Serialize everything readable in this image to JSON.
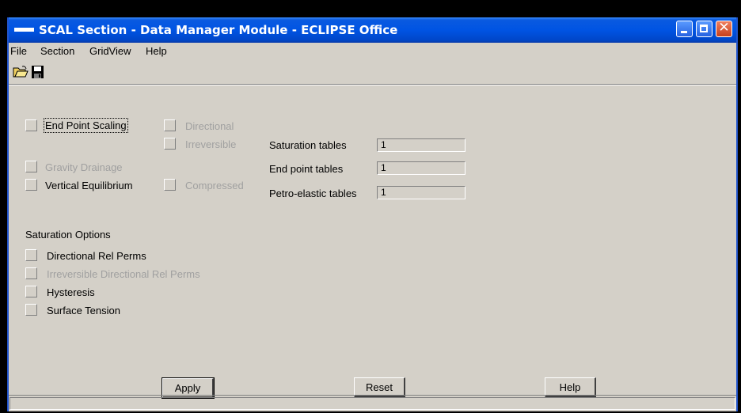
{
  "window": {
    "title": "SCAL Section - Data Manager Module - ECLIPSE Office"
  },
  "menu": [
    "File",
    "Section",
    "GridView",
    "Help"
  ],
  "toolbar": {
    "icons": [
      "open-folder-icon",
      "save-disk-icon"
    ]
  },
  "options": {
    "end_point_scaling": "End Point Scaling",
    "directional": "Directional",
    "irreversible": "Irreversible",
    "gravity_drainage": "Gravity Drainage",
    "vertical_equilibrium": "Vertical Equilibrium",
    "compressed": "Compressed"
  },
  "tables": {
    "saturation_label": "Saturation tables",
    "saturation_value": "1",
    "end_point_label": "End point tables",
    "end_point_value": "1",
    "petro_label": "Petro-elastic tables",
    "petro_value": "1"
  },
  "saturation_options": {
    "heading": "Saturation Options",
    "directional_rel_perms": "Directional Rel Perms",
    "irreversible_directional_rel_perms": "Irreversible Directional Rel Perms",
    "hysteresis": "Hysteresis",
    "surface_tension": "Surface Tension"
  },
  "buttons": {
    "apply": "Apply",
    "reset": "Reset",
    "help": "Help"
  },
  "colors": {
    "title_bar": "#0054e3",
    "face": "#d4d0c8",
    "disabled_text": "#a0a0a0"
  }
}
